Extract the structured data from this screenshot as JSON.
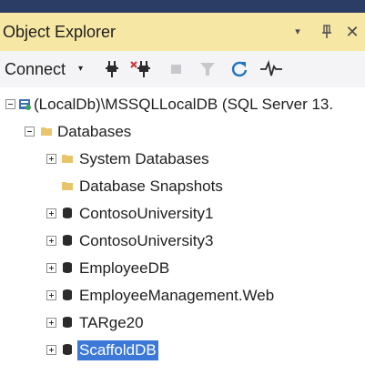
{
  "panel": {
    "title": "Object Explorer",
    "menu_glyph": "▾",
    "pin_glyph": "⊥",
    "close_glyph": "✕"
  },
  "toolbar": {
    "connect_label": "Connect",
    "connect_arrow": "▾",
    "icons": [
      "connect-icon",
      "disconnect-icon",
      "stop-icon",
      "filter-icon",
      "refresh-icon",
      "activity-monitor-icon"
    ]
  },
  "tree": {
    "server": {
      "label": "(LocalDb)\\MSSQLLocalDB (SQL Server 13.",
      "expanded": true
    },
    "databases_folder": {
      "label": "Databases",
      "expanded": true
    },
    "items": [
      {
        "label": "System Databases",
        "type": "folder",
        "expandable": true
      },
      {
        "label": "Database Snapshots",
        "type": "folder",
        "expandable": false
      },
      {
        "label": "ContosoUniversity1",
        "type": "database",
        "expandable": true
      },
      {
        "label": "ContosoUniversity3",
        "type": "database",
        "expandable": true
      },
      {
        "label": "EmployeeDB",
        "type": "database",
        "expandable": true
      },
      {
        "label": "EmployeeManagement.Web",
        "type": "database",
        "expandable": true
      },
      {
        "label": "TARge20",
        "type": "database",
        "expandable": true
      },
      {
        "label": "ScaffoldDB",
        "type": "database",
        "expandable": true,
        "selected": true
      }
    ]
  },
  "colors": {
    "title_bar": "#f7e7a5",
    "toolbar": "#f4f4f6",
    "selection": "#3b78d8",
    "folder": "#e8c46a",
    "database": "#2b2b2b"
  }
}
